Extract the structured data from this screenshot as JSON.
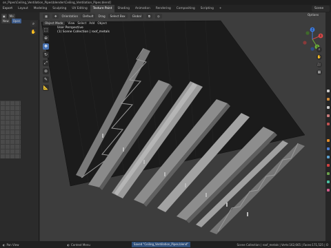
{
  "window_title": "on_Pipes\\Ceiling_Ventilation_Pipes\\blender\\Ceiling_Ventilation_Pipes.blend]",
  "menu": {
    "items": [
      "Layout",
      "Modeling",
      "Sculpting",
      "UV Editing",
      "Texture Paint",
      "Shading",
      "Animation",
      "Rendering",
      "Compositing",
      "Scripting"
    ],
    "active": "Texture Paint",
    "first_label": "Export"
  },
  "scene": {
    "label": "Scene"
  },
  "left_panel": {
    "mode_field": "Mo",
    "buttons": {
      "new": "New",
      "open": "Open"
    }
  },
  "viewport": {
    "header": {
      "orientation_label": "Orientation",
      "orientation_value": "Default",
      "drag_label": "Drag",
      "drag_value": "Select Box",
      "pivot_value": "Global",
      "options_label": "Options"
    },
    "header2": {
      "mode": "Object Mode",
      "menus": [
        "View",
        "Select",
        "Add",
        "Object"
      ]
    },
    "info_line1": "User Perspective",
    "info_line2": "(1) Scene Collection | roof_metals"
  },
  "gizmo": {
    "x_label": "X",
    "y_label": "Y",
    "z_label": "Z"
  },
  "tools": [
    "select-box",
    "cursor",
    "move",
    "rotate",
    "scale",
    "transform",
    "annotate",
    "measure"
  ],
  "status": {
    "left": "Pan View",
    "middle": "Context Menu",
    "message": "Saved \"Ceiling_Ventilation_Pipes.blend\"",
    "right": "Scene Collection | roof_metals | Verts:162,665 | Faces:171,525 | O"
  },
  "colors": {
    "accent_blue": "#4772b3",
    "panel_bg": "#303030",
    "viewport_bg": "#3d3d3d",
    "ceiling": "#1b1b1b"
  }
}
